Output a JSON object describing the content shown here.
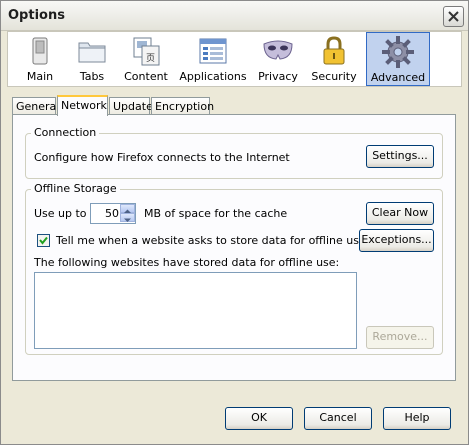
{
  "window": {
    "title": "Options"
  },
  "toolbar": {
    "panes": [
      {
        "label": "Main",
        "icon": "switch-icon"
      },
      {
        "label": "Tabs",
        "icon": "folder-tabs-icon"
      },
      {
        "label": "Content",
        "icon": "content-pages-icon"
      },
      {
        "label": "Applications",
        "icon": "applications-list-icon"
      },
      {
        "label": "Privacy",
        "icon": "mask-icon"
      },
      {
        "label": "Security",
        "icon": "padlock-icon"
      },
      {
        "label": "Advanced",
        "icon": "gear-icon"
      }
    ],
    "selected": "Advanced"
  },
  "tabs": [
    {
      "label": "General"
    },
    {
      "label": "Network"
    },
    {
      "label": "Update"
    },
    {
      "label": "Encryption"
    }
  ],
  "active_tab": "Network",
  "connection": {
    "legend": "Connection",
    "description": "Configure how Firefox connects to the Internet",
    "settings_button": "Settings..."
  },
  "offline": {
    "legend": "Offline Storage",
    "use_up_to": "Use up to",
    "cache_value": "50",
    "cache_suffix": "MB of space for the cache",
    "clear_now_button": "Clear Now",
    "tell_me_label": "Tell me when a website asks to store data for offline use",
    "tell_me_checked": true,
    "exceptions_button": "Exceptions...",
    "stored_label": "The following websites have stored data for offline use:",
    "stored_sites": [],
    "remove_button": "Remove..."
  },
  "buttons": {
    "ok": "OK",
    "cancel": "Cancel",
    "help": "Help"
  },
  "colors": {
    "selected_pane": "#c1d2ee",
    "dialog_bg": "#ece9d8",
    "tab_highlight": "#ffc83c",
    "check": "#21a121"
  }
}
